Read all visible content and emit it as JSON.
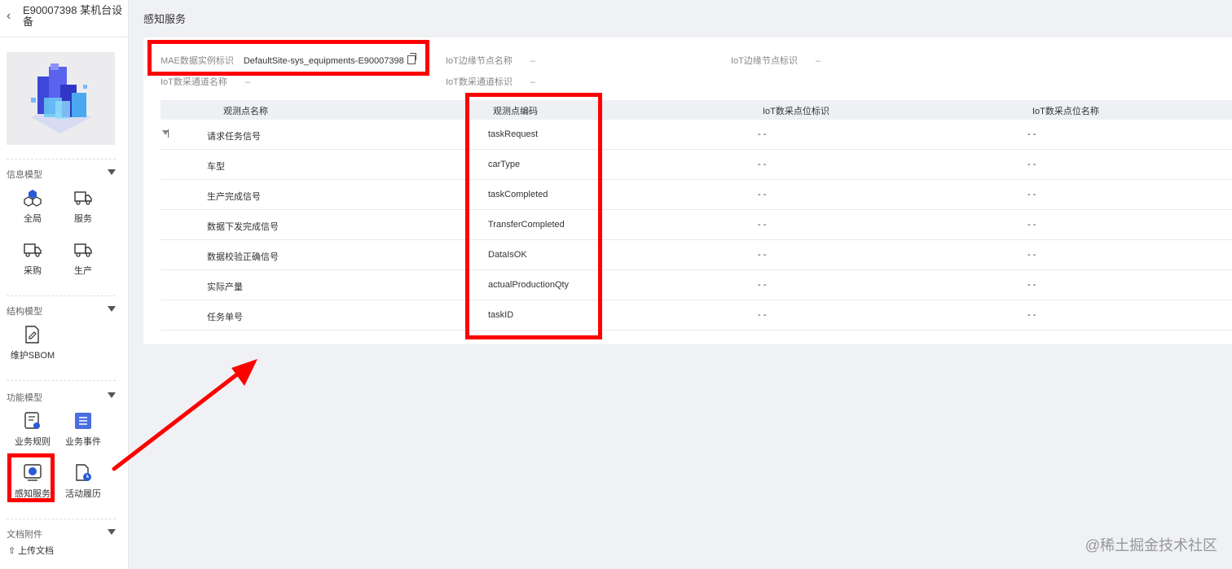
{
  "sidebar": {
    "title": "E90007398 某机台设备",
    "back_icon": "chevron-left-icon",
    "sections": [
      {
        "title": "信息模型",
        "items": [
          {
            "label": "全局",
            "icon": "hexagon-cluster-icon"
          },
          {
            "label": "服务",
            "icon": "truck-icon"
          },
          {
            "label": "采购",
            "icon": "truck-icon"
          },
          {
            "label": "生产",
            "icon": "truck-icon"
          }
        ]
      },
      {
        "title": "结构模型",
        "items": [
          {
            "label": "维护SBOM",
            "icon": "document-edit-icon"
          }
        ]
      },
      {
        "title": "功能模型",
        "items": [
          {
            "label": "业务规则",
            "icon": "rule-document-icon"
          },
          {
            "label": "业务事件",
            "icon": "event-list-icon"
          },
          {
            "label": "感知服务",
            "icon": "monitor-icon"
          },
          {
            "label": "活动履历",
            "icon": "history-document-icon"
          }
        ]
      },
      {
        "title": "文档附件",
        "items": []
      }
    ],
    "upload_label": "上传文档"
  },
  "main": {
    "title": "感知服务",
    "fields": {
      "mae_label": "MAE数据实例标识",
      "mae_value": "DefaultSite-sys_equipments-E90007398",
      "edge_name_label": "IoT边缘节点名称",
      "edge_name_value": "–",
      "edge_id_label": "IoT边缘节点标识",
      "edge_id_value": "–",
      "channel_name_label": "IoT数采通道名称",
      "channel_name_value": "–",
      "channel_id_label": "IoT数采通道标识",
      "channel_id_value": "–"
    },
    "table": {
      "columns": [
        "观测点名称",
        "观测点编码",
        "IoT数采点位标识",
        "IoT数采点位名称"
      ],
      "rows": [
        {
          "name": "请求任务信号",
          "code": "taskRequest",
          "point_id": "- -",
          "point_name": "- -"
        },
        {
          "name": "车型",
          "code": "carType",
          "point_id": "- -",
          "point_name": "- -"
        },
        {
          "name": "生产完成信号",
          "code": "taskCompleted",
          "point_id": "- -",
          "point_name": "- -"
        },
        {
          "name": "数据下发完成信号",
          "code": "TransferCompleted",
          "point_id": "- -",
          "point_name": "- -"
        },
        {
          "name": "数据校验正确信号",
          "code": "DataIsOK",
          "point_id": "- -",
          "point_name": "- -"
        },
        {
          "name": "实际产量",
          "code": "actualProductionQty",
          "point_id": "- -",
          "point_name": "- -"
        },
        {
          "name": "任务单号",
          "code": "taskID",
          "point_id": "- -",
          "point_name": "- -"
        }
      ]
    }
  },
  "annotation_color": "#ff0000",
  "watermark": "@稀土掘金技术社区"
}
